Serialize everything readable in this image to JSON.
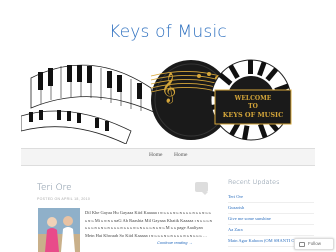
{
  "site": {
    "title": "Keys of Music"
  },
  "header": {
    "banner_line1": "WELCOME",
    "banner_line2": "TO",
    "banner_line3": "KEYS OF MUSIC"
  },
  "menu": {
    "items": [
      "Home",
      "Home"
    ]
  },
  "post": {
    "title": "Teri Ore",
    "meta": "POSTED ON APRIL 18, 2010",
    "excerpt": "Dil Khe Gayaa Hu  Gayaaa Kiid Kaaaaa ɪ  ɴ ɢ ɢ ɢ ɴ ɢ ɴ ɢ ɢ ɢ ɴ ɢ ɢ ɴ ɢ ɢ ɢ ɴ ɢ Mi ɢ ɴ ɴ ɢ ɴaG Ab Raashta Mil Gayaaa Khatik Kaaaaa ɪ ɴ ɢ ɢ ɢ ɴ ɢ ɢ ɢ ɴ ɢ ɴ ɢ ɴ ɢ ɢ ɢ ɴ ɢ ɢ ɢ ɴ ɢ ɴ ɢ ɢ ɢ ɴ ɢ ɴ ɢ M ɢ ɢ page Aaaliyan Mein Hai Khwaab So  Kiid Kaaaaa ɪ ɴ ɢ ɢ ɢ ɴ ɢ ɴ ɢ ɢ ɢ ɴ ɢ ɴ ɢ ɢ ɢ …",
    "continue": "Continue reading →"
  },
  "sidebar": {
    "title": "Recent Updates",
    "items": [
      "Teri Ore",
      "Guzarish",
      "Give me some sunshine",
      "Aa Zara",
      "Main Agar Kahoon (OM SHANTI OM)"
    ]
  },
  "follow": {
    "label": "Follow"
  },
  "colors": {
    "accent": "#2c6fbf",
    "banner_bg": "#1a1a1a",
    "banner_gold": "#d6a73a"
  }
}
